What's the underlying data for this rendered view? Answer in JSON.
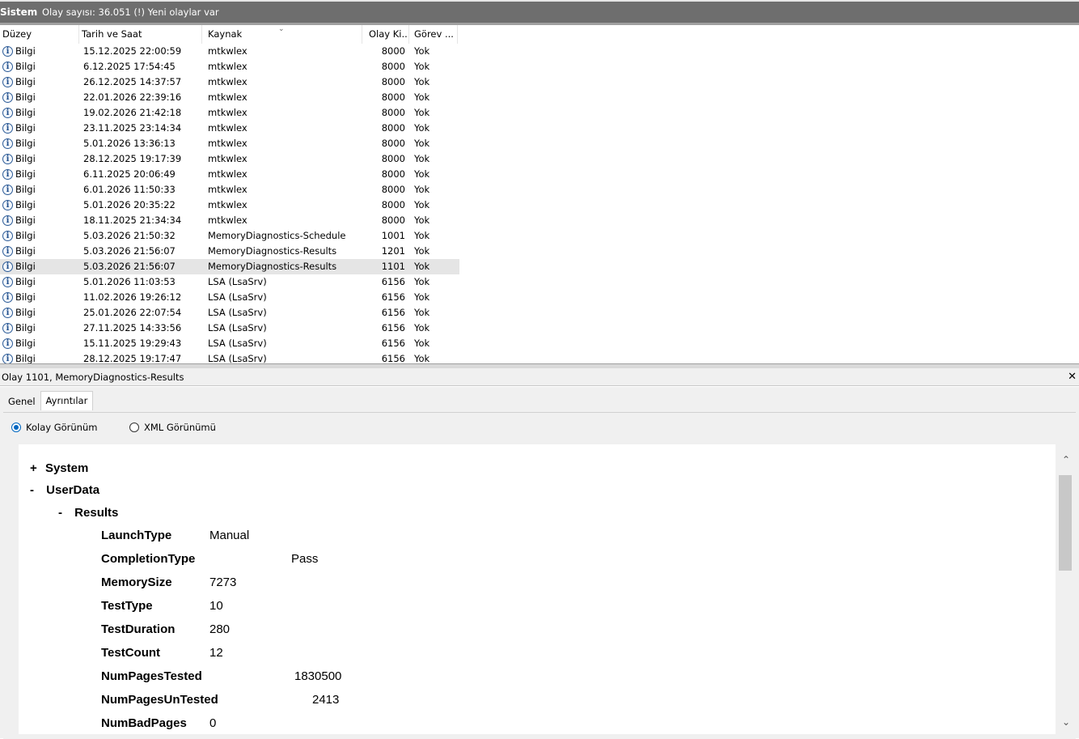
{
  "titlebar": {
    "log_name": "Sistem",
    "info": "Olay sayısı: 36.051 (!) Yeni olaylar var"
  },
  "grid": {
    "columns": [
      "Düzey",
      "Tarih ve Saat",
      "Kaynak",
      "Olay Ki...",
      "Görev ..."
    ],
    "rows": [
      {
        "level": "Bilgi",
        "date": "15.12.2025 22:00:59",
        "source": "mtkwlex",
        "id": "8000",
        "task": "Yok"
      },
      {
        "level": "Bilgi",
        "date": "6.12.2025 17:54:45",
        "source": "mtkwlex",
        "id": "8000",
        "task": "Yok"
      },
      {
        "level": "Bilgi",
        "date": "26.12.2025 14:37:57",
        "source": "mtkwlex",
        "id": "8000",
        "task": "Yok"
      },
      {
        "level": "Bilgi",
        "date": "22.01.2026 22:39:16",
        "source": "mtkwlex",
        "id": "8000",
        "task": "Yok"
      },
      {
        "level": "Bilgi",
        "date": "19.02.2026 21:42:18",
        "source": "mtkwlex",
        "id": "8000",
        "task": "Yok"
      },
      {
        "level": "Bilgi",
        "date": "23.11.2025 23:14:34",
        "source": "mtkwlex",
        "id": "8000",
        "task": "Yok"
      },
      {
        "level": "Bilgi",
        "date": "5.01.2026 13:36:13",
        "source": "mtkwlex",
        "id": "8000",
        "task": "Yok"
      },
      {
        "level": "Bilgi",
        "date": "28.12.2025 19:17:39",
        "source": "mtkwlex",
        "id": "8000",
        "task": "Yok"
      },
      {
        "level": "Bilgi",
        "date": "6.11.2025 20:06:49",
        "source": "mtkwlex",
        "id": "8000",
        "task": "Yok"
      },
      {
        "level": "Bilgi",
        "date": "6.01.2026 11:50:33",
        "source": "mtkwlex",
        "id": "8000",
        "task": "Yok"
      },
      {
        "level": "Bilgi",
        "date": "5.01.2026 20:35:22",
        "source": "mtkwlex",
        "id": "8000",
        "task": "Yok"
      },
      {
        "level": "Bilgi",
        "date": "18.11.2025 21:34:34",
        "source": "mtkwlex",
        "id": "8000",
        "task": "Yok"
      },
      {
        "level": "Bilgi",
        "date": "5.03.2026 21:50:32",
        "source": "MemoryDiagnostics-Schedule",
        "id": "1001",
        "task": "Yok"
      },
      {
        "level": "Bilgi",
        "date": "5.03.2026 21:56:07",
        "source": "MemoryDiagnostics-Results",
        "id": "1201",
        "task": "Yok"
      },
      {
        "level": "Bilgi",
        "date": "5.03.2026 21:56:07",
        "source": "MemoryDiagnostics-Results",
        "id": "1101",
        "task": "Yok",
        "selected": true
      },
      {
        "level": "Bilgi",
        "date": "5.01.2026 11:03:53",
        "source": "LSA (LsaSrv)",
        "id": "6156",
        "task": "Yok"
      },
      {
        "level": "Bilgi",
        "date": "11.02.2026 19:26:12",
        "source": "LSA (LsaSrv)",
        "id": "6156",
        "task": "Yok"
      },
      {
        "level": "Bilgi",
        "date": "25.01.2026 22:07:54",
        "source": "LSA (LsaSrv)",
        "id": "6156",
        "task": "Yok"
      },
      {
        "level": "Bilgi",
        "date": "27.11.2025 14:33:56",
        "source": "LSA (LsaSrv)",
        "id": "6156",
        "task": "Yok"
      },
      {
        "level": "Bilgi",
        "date": "15.11.2025 19:29:43",
        "source": "LSA (LsaSrv)",
        "id": "6156",
        "task": "Yok"
      },
      {
        "level": "Bilgi",
        "date": "28.12.2025 19:17:47",
        "source": "LSA (LsaSrv)",
        "id": "6156",
        "task": "Yok"
      }
    ]
  },
  "event_title": "Olay 1101, MemoryDiagnostics-Results",
  "tabs": [
    "Genel",
    "Ayrıntılar"
  ],
  "views": {
    "friendly": "Kolay Görünüm",
    "xml": "XML Görünümü"
  },
  "tree": {
    "system_toggle": "+",
    "system": "System",
    "userdata_toggle": "-",
    "userdata": "UserData",
    "results_toggle": "-",
    "results": "Results",
    "fields": [
      {
        "key": "LaunchType",
        "value": "Manual"
      },
      {
        "key": "CompletionType",
        "value": "Pass"
      },
      {
        "key": "MemorySize",
        "value": "7273"
      },
      {
        "key": "TestType",
        "value": "10"
      },
      {
        "key": "TestDuration",
        "value": "280"
      },
      {
        "key": "TestCount",
        "value": "12"
      },
      {
        "key": "NumPagesTested",
        "value": "1830500"
      },
      {
        "key": "NumPagesUnTested",
        "value": "2413"
      },
      {
        "key": "NumBadPages",
        "value": "0"
      }
    ]
  }
}
